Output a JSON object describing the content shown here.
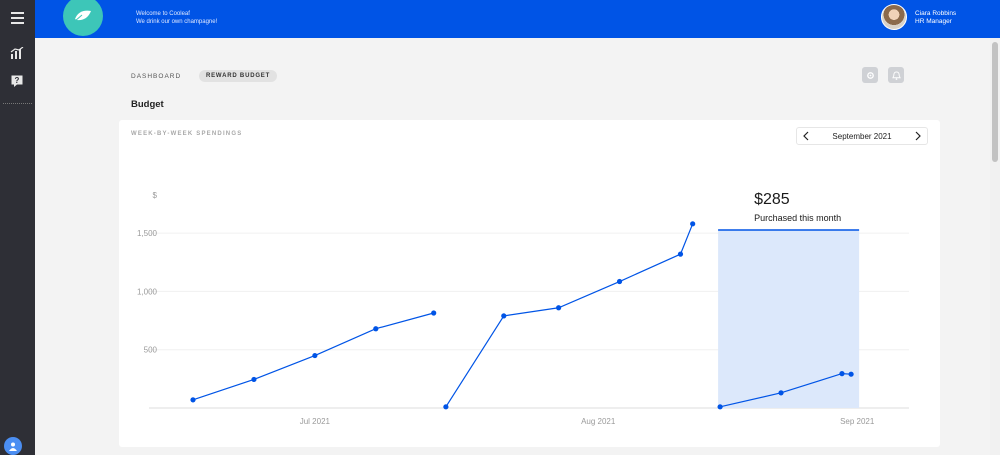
{
  "app": {
    "welcome_line1": "Welcome to Cooleaf",
    "welcome_line2": "We drink our own champagne!",
    "user_name": "Ciara Robbins",
    "user_role": "HR Manager",
    "brand_color": "#0054e6",
    "logo_color": "#3dc6b8"
  },
  "rail": {
    "icons": [
      "menu-icon",
      "bar-chart-icon",
      "question-icon",
      "user-avatar-icon"
    ]
  },
  "breadcrumb": {
    "dashboard": "DASHBOARD",
    "current": "REWARD BUDGET"
  },
  "page": {
    "title": "Budget"
  },
  "header_icons": [
    "settings-icon",
    "bell-icon"
  ],
  "card": {
    "label": "WEEK-BY-WEEK SPENDINGS",
    "month": "September 2021",
    "prev_icon": "chevron-left-icon",
    "next_icon": "chevron-right-icon"
  },
  "chart_data": {
    "type": "line",
    "yunit": "$",
    "ylim": [
      0,
      1750
    ],
    "yticks": [
      500,
      1000,
      1500
    ],
    "ytick_labels": [
      "500",
      "1,000",
      "1,500"
    ],
    "xticks": [
      {
        "label": "Jul 2021",
        "week": 4
      },
      {
        "label": "Aug 2021",
        "week": 13.3
      },
      {
        "label": "Sep 2021",
        "week": 21.8
      }
    ],
    "series": [
      {
        "points": [
          [
            0,
            70
          ],
          [
            2,
            245
          ],
          [
            4,
            450
          ],
          [
            6,
            680
          ],
          [
            7.9,
            815
          ]
        ]
      },
      {
        "points": [
          [
            8.3,
            10
          ],
          [
            10.2,
            790
          ],
          [
            12,
            860
          ],
          [
            14,
            1085
          ],
          [
            16,
            1320
          ],
          [
            16.4,
            1580
          ]
        ]
      },
      {
        "points": [
          [
            17.3,
            10
          ],
          [
            19.3,
            130
          ],
          [
            21.3,
            295
          ],
          [
            21.6,
            290
          ]
        ]
      }
    ],
    "highlight": {
      "from_week": 17.3,
      "to_week": 21.6,
      "value": "$285",
      "label": "Purchased this month"
    },
    "grid": true,
    "line_color": "#0054e6",
    "highlight_color": "#dce8fb"
  }
}
